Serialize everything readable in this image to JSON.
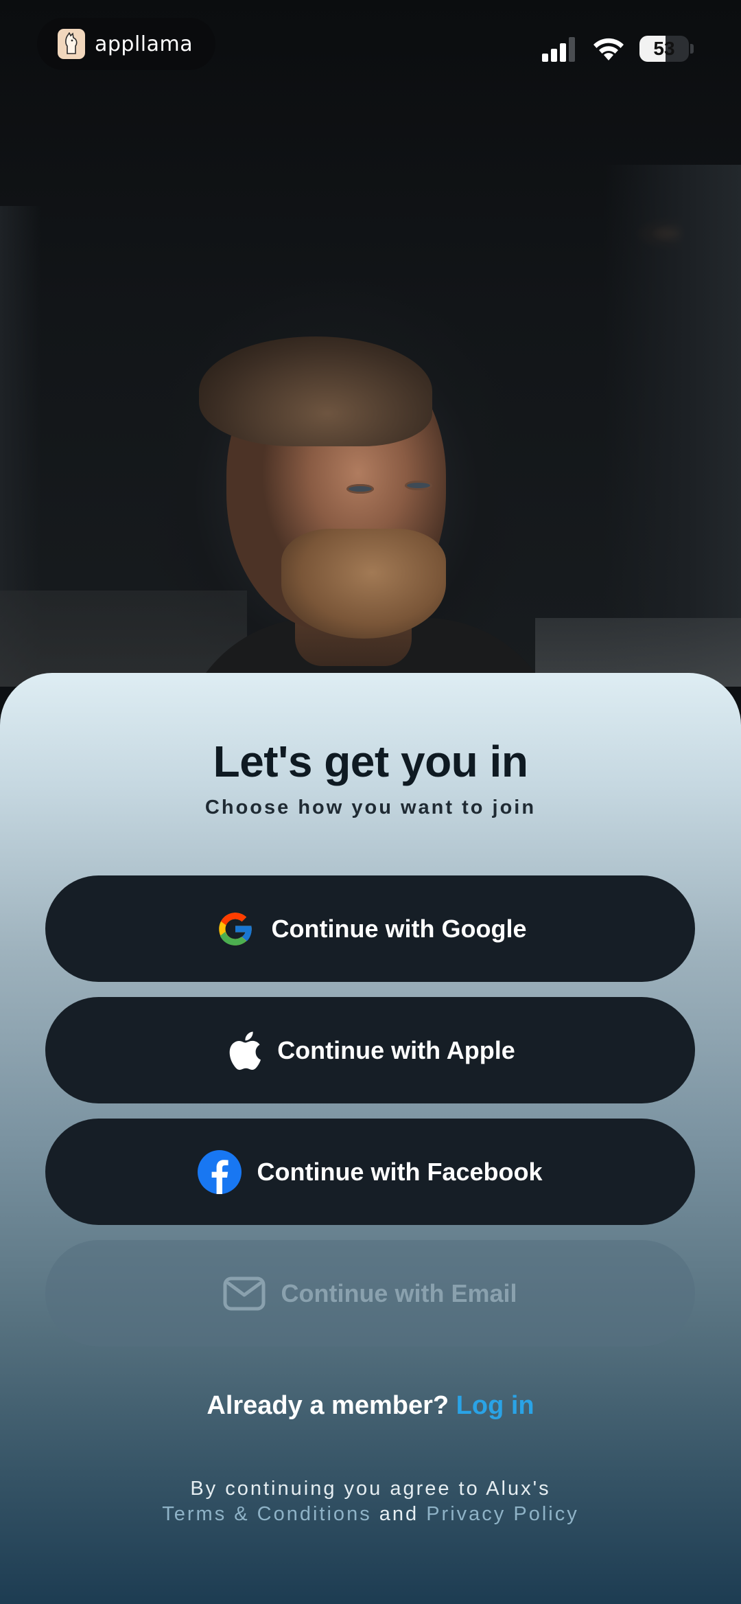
{
  "status_bar": {
    "app_name": "appllama",
    "battery_percent": "53",
    "battery_level": 0.53
  },
  "hero": {
    "image": "man-portrait-photo"
  },
  "sheet": {
    "title": "Let's get you in",
    "subtitle": "Choose how you want to join",
    "buttons": [
      {
        "label": "Continue with Google",
        "icon": "google-icon"
      },
      {
        "label": "Continue with Apple",
        "icon": "apple-icon"
      },
      {
        "label": "Continue with Facebook",
        "icon": "facebook-icon"
      },
      {
        "label": "Continue with Email",
        "icon": "mail-icon"
      }
    ],
    "member_prompt": "Already a member?",
    "login_link": "Log in",
    "legal": {
      "line1": "By continuing you agree to Alux's",
      "terms": "Terms & Conditions",
      "and": "and",
      "privacy": "Privacy Policy"
    }
  },
  "colors": {
    "button_bg": "#161e26",
    "link": "#2aa3e6",
    "facebook": "#1877f2"
  }
}
